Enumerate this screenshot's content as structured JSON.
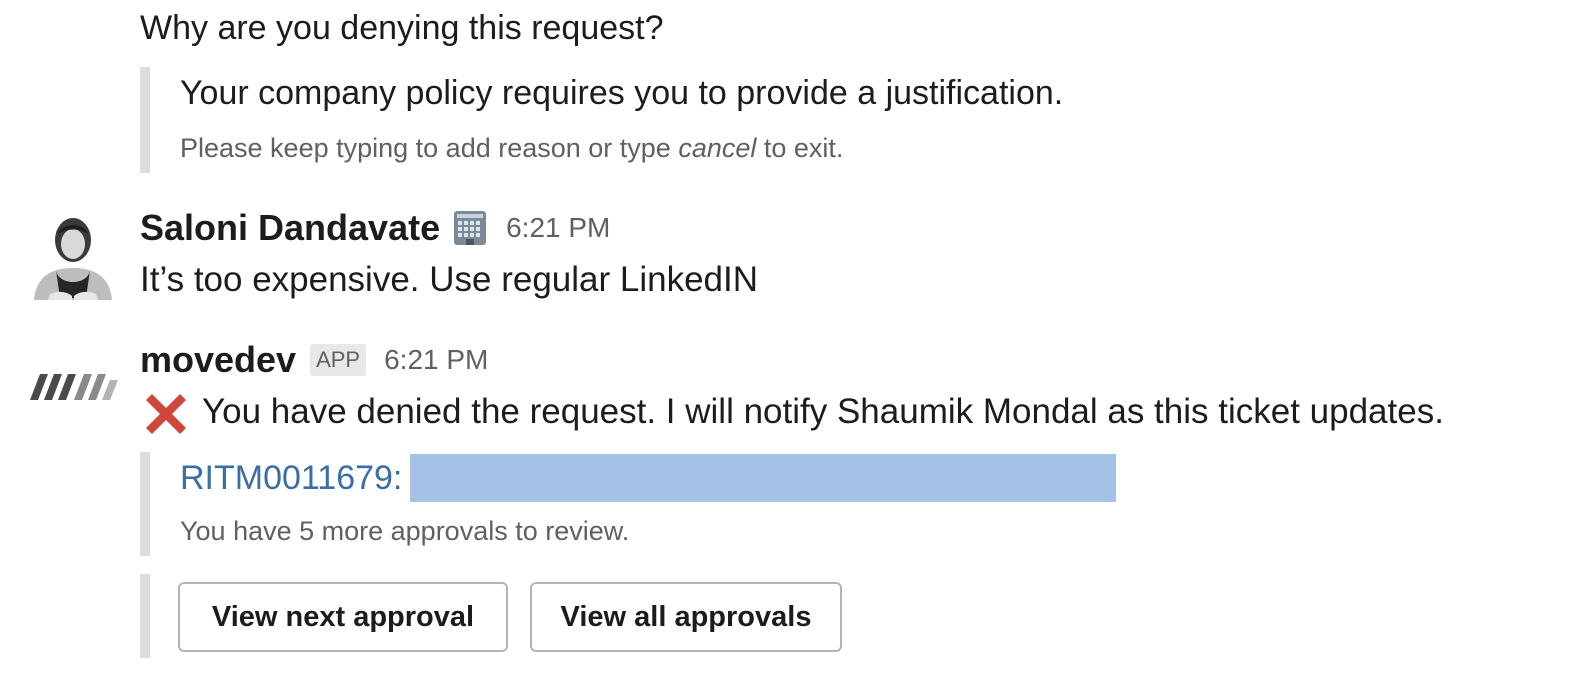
{
  "prompt": {
    "question": "Why are you denying this request?",
    "policy_text": "Your company policy requires you to provide a justification.",
    "hint_prefix": "Please keep typing to add reason or type ",
    "hint_keyword": "cancel",
    "hint_suffix": " to exit."
  },
  "messages": [
    {
      "sender": "Saloni Dandavate",
      "status_icon": "building-icon",
      "time": "6:21 PM",
      "text": "It’s too expensive. Use regular LinkedIN"
    },
    {
      "sender": "movedev",
      "badge": "APP",
      "time": "6:21 PM",
      "status_icon": "red-x-icon",
      "text": "You have denied the request. I will notify Shaumik Mondal as this ticket updates.",
      "ticket": {
        "id_label": "RITM0011679:",
        "remaining_text": "You have 5 more approvals to review."
      },
      "actions": {
        "next_label": "View next approval",
        "all_label": "View all approvals"
      }
    }
  ],
  "colors": {
    "link": "#3b6ea5",
    "redaction": "#a5c2e6",
    "attachment_bar": "#dddddd",
    "deny_red": "#d0463a"
  }
}
